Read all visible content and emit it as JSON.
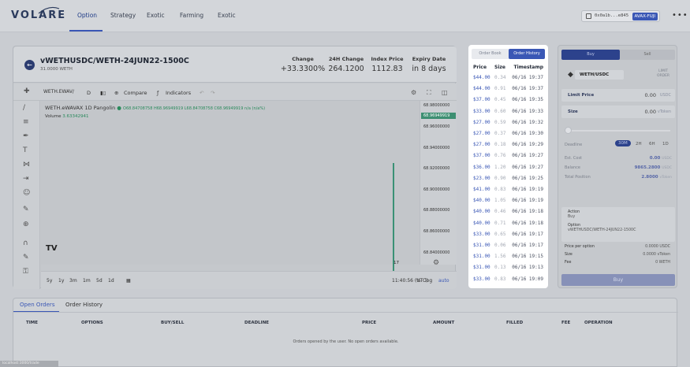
{
  "navbar": {
    "logo": "VOLARE",
    "items": [
      {
        "label": "Option",
        "active": true
      },
      {
        "label": "Strategy",
        "active": false
      },
      {
        "label": "Exotic",
        "active": false
      },
      {
        "label": "Farming",
        "active": false
      },
      {
        "label": "Exotic",
        "active": false
      }
    ],
    "wallet_address": "0x0a1b...e845",
    "network": "AVAX-FUJI",
    "more": "•••"
  },
  "chart_header": {
    "pair": "vWETHUSDC/WETH-24JUN22-1500C",
    "sub": "31.0000 WETH",
    "stats": [
      {
        "label": "Change",
        "value": "+33.3300%"
      },
      {
        "label": "24H Change",
        "value": "264.1200"
      },
      {
        "label": "Index Price",
        "value": "1112.83"
      },
      {
        "label": "Expiry Date",
        "value": "in 8 days"
      }
    ]
  },
  "chart": {
    "symbol": "WETH.EWAV/",
    "interval": "D",
    "compare": "Compare",
    "indicators": "Indicators",
    "info_title": "WETH.eWAVAX  1D  Pangolin",
    "ohlc": "O68.84708758 H68.96949919 L68.84708758 C68.96949919 n/a (n/a%)",
    "volume_label": "Volume",
    "volume_value": "3.63342941",
    "price_ticks": [
      "68.98000000",
      "68.96000000",
      "68.94000000",
      "68.92000000",
      "68.90000000",
      "68.88000000",
      "68.86000000",
      "68.84000000"
    ],
    "price_tag": "68.96949919",
    "time_label": "17",
    "ranges": [
      "5y",
      "1y",
      "3m",
      "1m",
      "5d",
      "1d"
    ],
    "clock": "11:40:56 (UTC)",
    "scale_pct": "%",
    "scale_log": "log",
    "scale_auto": "auto",
    "tv_logo": "TV"
  },
  "order_history": {
    "tab_book": "Order Book",
    "tab_history": "Order History",
    "headers": {
      "price": "Price",
      "size": "Size",
      "timestamp": "Timestamp"
    },
    "rows": [
      {
        "price": "$44.00",
        "size": "0.34",
        "time": "06/16 19:37"
      },
      {
        "price": "$44.00",
        "size": "0.91",
        "time": "06/16 19:37"
      },
      {
        "price": "$37.00",
        "size": "0.45",
        "time": "06/16 19:35"
      },
      {
        "price": "$33.00",
        "size": "0.60",
        "time": "06/16 19:33"
      },
      {
        "price": "$27.00",
        "size": "0.59",
        "time": "06/16 19:32"
      },
      {
        "price": "$27.00",
        "size": "0.37",
        "time": "06/16 19:30"
      },
      {
        "price": "$27.00",
        "size": "0.18",
        "time": "06/16 19:29"
      },
      {
        "price": "$37.00",
        "size": "0.76",
        "time": "06/16 19:27"
      },
      {
        "price": "$36.00",
        "size": "1.20",
        "time": "06/16 19:27"
      },
      {
        "price": "$23.00",
        "size": "0.90",
        "time": "06/16 19:25"
      },
      {
        "price": "$41.00",
        "size": "0.83",
        "time": "06/16 19:19"
      },
      {
        "price": "$40.00",
        "size": "1.05",
        "time": "06/16 19:19"
      },
      {
        "price": "$40.00",
        "size": "0.46",
        "time": "06/16 19:18"
      },
      {
        "price": "$40.00",
        "size": "0.71",
        "time": "06/16 19:18"
      },
      {
        "price": "$33.00",
        "size": "0.65",
        "time": "06/16 19:17"
      },
      {
        "price": "$31.00",
        "size": "0.06",
        "time": "06/16 19:17"
      },
      {
        "price": "$31.00",
        "size": "1.56",
        "time": "06/16 19:15"
      },
      {
        "price": "$31.00",
        "size": "0.13",
        "time": "06/16 19:13"
      },
      {
        "price": "$33.00",
        "size": "0.83",
        "time": "06/16 19:09"
      }
    ]
  },
  "trade": {
    "buy_tab": "Buy",
    "sell_tab": "Sell",
    "token": "WETH/USDC",
    "limit_order": "LIMIT ORDER",
    "limit_price_label": "Limit Price",
    "limit_price_value": "0.00",
    "limit_price_unit": "USDC",
    "size_label": "Size",
    "size_value": "0.00",
    "size_unit": "vToken",
    "deadline_label": "Deadline",
    "deadline_options": [
      {
        "label": "30M",
        "active": true
      },
      {
        "label": "2H",
        "active": false
      },
      {
        "label": "6H",
        "active": false
      },
      {
        "label": "1D",
        "active": false
      }
    ],
    "est_cost_label": "Est. Cost",
    "est_cost_value": "0.00",
    "est_cost_unit": "USDC",
    "balance_label": "Balance",
    "balance_value": "9865.2800",
    "balance_unit": "USDC",
    "total_position_label": "Total Position",
    "total_position_value": "2.8000",
    "total_position_unit": "vToken",
    "action_label": "Action",
    "action_value": "Buy",
    "option_label": "Option",
    "option_value": "vWETHUSDC/WETH-24JUN22-1500C",
    "ppo_label": "Price per option",
    "ppo_value": "0.0000 USDC",
    "sum_size_label": "Size",
    "sum_size_value": "0.0000 vToken",
    "fee_label": "Fee",
    "fee_value": "0 WETH",
    "buy_button": "Buy"
  },
  "orders": {
    "tab_open": "Open Orders",
    "tab_history": "Order History",
    "columns": [
      "TIME",
      "OPTIONS",
      "BUY/SELL",
      "DEADLINE",
      "PRICE",
      "AMOUNT",
      "FILLED",
      "FEE",
      "OPERATION"
    ],
    "empty_text": "Orders opened by the user. No open orders available."
  },
  "status_bar": "localhost:3000/trade"
}
